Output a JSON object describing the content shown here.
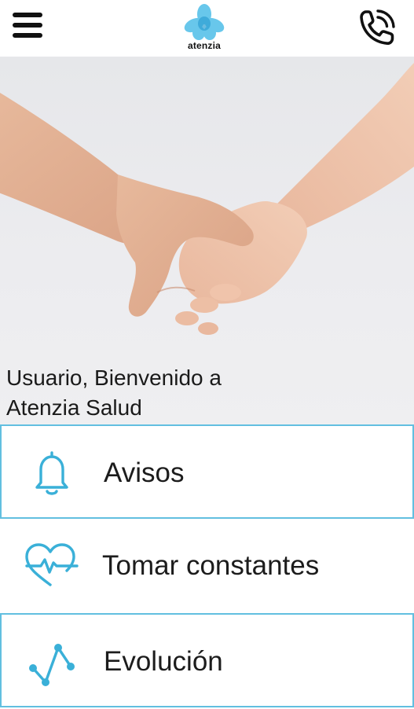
{
  "header": {
    "logo_text": "atenzia",
    "menu_icon": "hamburger-menu-icon",
    "phone_icon": "phone-call-icon"
  },
  "hero": {
    "welcome_line1": "Usuario, Bienvenido a",
    "welcome_line2": "Atenzia Salud"
  },
  "menu": {
    "items": [
      {
        "label": "Avisos",
        "icon": "bell-icon"
      },
      {
        "label": "Tomar constantes",
        "icon": "heart-pulse-icon"
      },
      {
        "label": "Evolución",
        "icon": "evolution-chart-icon"
      }
    ]
  },
  "colors": {
    "accent": "#3ab0d8",
    "border": "#62bfe0",
    "text": "#1c1c1c"
  }
}
